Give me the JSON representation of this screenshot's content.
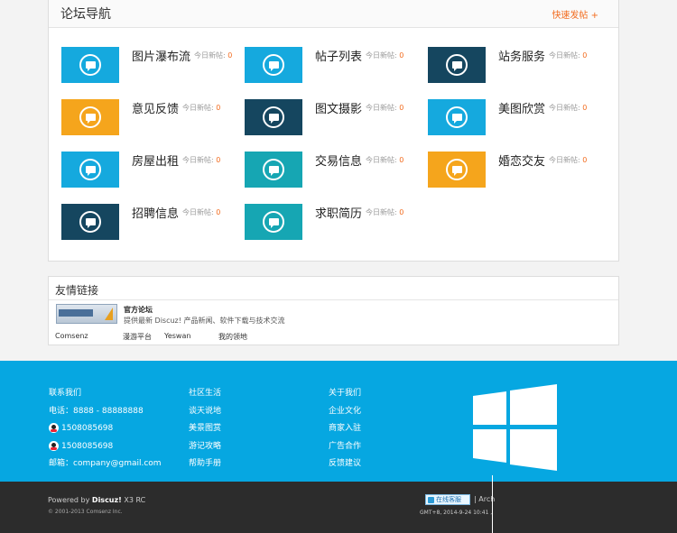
{
  "forum_nav": {
    "title": "论坛导航",
    "quick_post": "快速发帖 +",
    "today_label": "今日新帖:",
    "forums": [
      {
        "name": "图片瀑布流",
        "today": "0",
        "color": "#15a9de"
      },
      {
        "name": "帖子列表",
        "today": "0",
        "color": "#15a9de"
      },
      {
        "name": "站务服务",
        "today": "0",
        "color": "#15465f"
      },
      {
        "name": "意见反馈",
        "today": "0",
        "color": "#f5a51c"
      },
      {
        "name": "图文摄影",
        "today": "0",
        "color": "#15465f"
      },
      {
        "name": "美图欣赏",
        "today": "0",
        "color": "#15a9de"
      },
      {
        "name": "房屋出租",
        "today": "0",
        "color": "#15a9de"
      },
      {
        "name": "交易信息",
        "today": "0",
        "color": "#16a6b3"
      },
      {
        "name": "婚恋交友",
        "today": "0",
        "color": "#f5a51c"
      },
      {
        "name": "招聘信息",
        "today": "0",
        "color": "#15465f"
      },
      {
        "name": "求职简历",
        "today": "0",
        "color": "#16a6b3"
      }
    ]
  },
  "friend_links": {
    "title": "友情链接",
    "logo_text": "Discuz! net",
    "official_name": "官方论坛",
    "official_desc": "提供最新 Discuz! 产品新闻、软件下载与技术交流",
    "text_links": [
      "Comsenz",
      "漫游平台",
      "Yeswan",
      "我的领地"
    ]
  },
  "footer": {
    "col1": {
      "heading": "联系我们",
      "phone": "电话：8888 - 88888888",
      "qq1": "1508085698",
      "qq2": "1508085698",
      "email": "邮箱：company@gmail.com"
    },
    "col2": [
      "社区生活",
      "谈天说地",
      "美景图赏",
      "游记攻略",
      "帮助手册"
    ],
    "col3": [
      "关于我们",
      "企业文化",
      "商家入驻",
      "广告合作",
      "反馈建议"
    ],
    "powered_prefix": "Powered by",
    "powered_brand": "Discuz!",
    "powered_version": "X3 RC",
    "copyright": "© 2001-2013 Comsenz Inc.",
    "online_button": "在线客服",
    "archiver": "| Arch",
    "gmt": "GMT+8, 2014-9-24 10:41 ,"
  },
  "colors": {
    "accent_orange": "#f26c1f",
    "footer_blue": "#06a7e1",
    "footer_dark": "#2c2c2c"
  }
}
